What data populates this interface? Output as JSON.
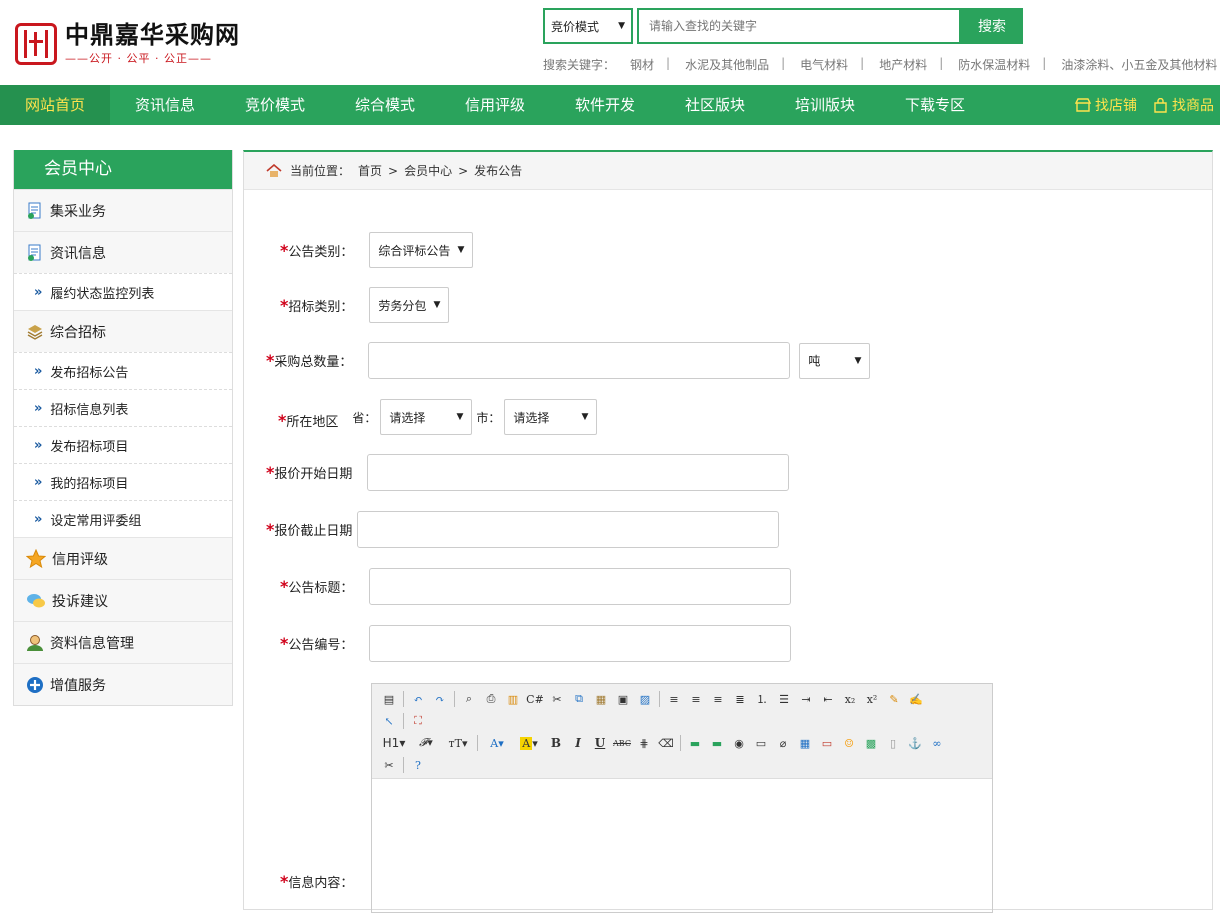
{
  "brand": {
    "title": "中鼎嘉华采购网",
    "slogan": "公开 · 公平 · 公正"
  },
  "search": {
    "mode": "竞价模式",
    "placeholder": "请输入查找的关键字",
    "button": "搜索"
  },
  "hotkeys": {
    "label": "搜索关键字：",
    "items": [
      "钢材",
      "水泥及其他制品",
      "电气材料",
      "地产材料",
      "防水保温材料",
      "油漆涂料、小五金及其他材料"
    ]
  },
  "nav": {
    "items": [
      "网站首页",
      "资讯信息",
      "竞价模式",
      "综合模式",
      "信用评级",
      "软件开发",
      "社区版块",
      "培训版块",
      "下载专区"
    ],
    "find_shop": "找店铺",
    "find_goods": "找商品"
  },
  "sidebar": {
    "title": "会员中心",
    "items": [
      {
        "label": "集采业务",
        "icon": "document-icon"
      },
      {
        "label": "资讯信息",
        "icon": "document-icon"
      },
      {
        "label": "履约状态监控列表",
        "sub": true
      },
      {
        "label": "综合招标",
        "icon": "layers-icon"
      },
      {
        "label": "发布招标公告",
        "sub": true
      },
      {
        "label": "招标信息列表",
        "sub": true
      },
      {
        "label": "发布招标项目",
        "sub": true
      },
      {
        "label": "我的招标项目",
        "sub": true
      },
      {
        "label": "设定常用评委组",
        "sub": true
      },
      {
        "label": "信用评级",
        "icon": "star-icon"
      },
      {
        "label": "投诉建议",
        "icon": "chat-icon"
      },
      {
        "label": "资料信息管理",
        "icon": "user-icon"
      },
      {
        "label": "增值服务",
        "icon": "plus-circle-icon"
      }
    ]
  },
  "breadcrumb": {
    "prefix": "当前位置：",
    "home": "首页",
    "section": "会员中心",
    "page": "发布公告",
    "sep": ">"
  },
  "form": {
    "notice_type": {
      "label": "公告类别：",
      "value": "综合评标公告"
    },
    "bid_type": {
      "label": "招标类别：",
      "value": "劳务分包"
    },
    "quantity": {
      "label": "采购总数量：",
      "unit": "吨"
    },
    "region": {
      "label": "所在地区",
      "province_label": "省：",
      "province": "请选择",
      "city_label": "市：",
      "city": "请选择"
    },
    "start_date": {
      "label": "报价开始日期"
    },
    "end_date": {
      "label": "报价截止日期"
    },
    "title": {
      "label": "公告标题："
    },
    "number": {
      "label": "公告编号："
    },
    "content": {
      "label": "信息内容："
    }
  },
  "editor": {
    "h1": "H1",
    "bold": "B",
    "italic": "I",
    "underline": "U",
    "strike": "ABC"
  },
  "colors": {
    "green": "#2aa35c",
    "dark_green": "#25914f",
    "nav_highlight": "#ffe34d",
    "required": "#d0021b",
    "brand_red": "#c9171e"
  }
}
